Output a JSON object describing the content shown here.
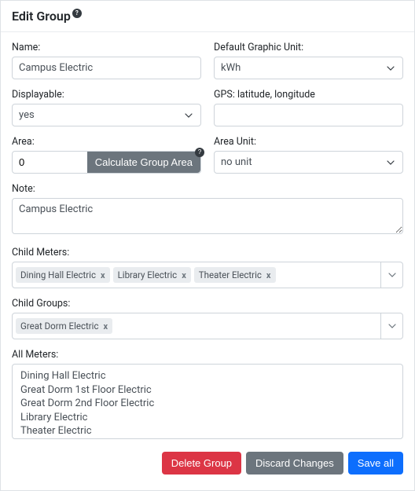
{
  "header": {
    "title": "Edit Group"
  },
  "fields": {
    "name": {
      "label": "Name:",
      "value": "Campus Electric"
    },
    "defaultUnit": {
      "label": "Default Graphic Unit:",
      "value": "kWh"
    },
    "displayable": {
      "label": "Displayable:",
      "value": "yes"
    },
    "gps": {
      "label": "GPS: latitude, longitude",
      "value": ""
    },
    "area": {
      "label": "Area:",
      "value": "0",
      "calcButton": "Calculate Group Area"
    },
    "areaUnit": {
      "label": "Area Unit:",
      "value": "no unit"
    },
    "note": {
      "label": "Note:",
      "value": "Campus Electric"
    }
  },
  "childMeters": {
    "label": "Child Meters:",
    "tags": [
      "Dining Hall Electric",
      "Library Electric",
      "Theater Electric"
    ]
  },
  "childGroups": {
    "label": "Child Groups:",
    "tags": [
      "Great Dorm Electric"
    ]
  },
  "allMeters": {
    "label": "All Meters:",
    "items": [
      "Dining Hall Electric",
      "Great Dorm 1st Floor Electric",
      "Great Dorm 2nd Floor Electric",
      "Library Electric",
      "Theater Electric"
    ]
  },
  "footer": {
    "delete": "Delete Group",
    "discard": "Discard Changes",
    "save": "Save all"
  }
}
